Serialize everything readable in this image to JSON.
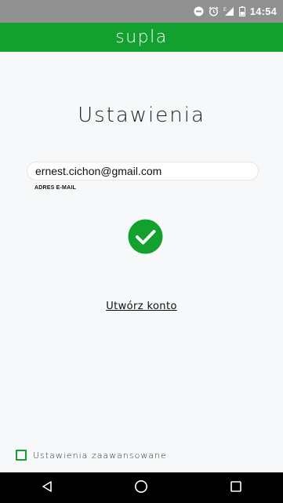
{
  "status_bar": {
    "time": "14:54",
    "icons": [
      "do-not-disturb-icon",
      "alarm-icon",
      "signal-icon",
      "battery-icon"
    ]
  },
  "app_bar": {
    "logo": "supla",
    "color": "#12a12f"
  },
  "page": {
    "title": "Ustawienia"
  },
  "email": {
    "value": "ernest.cichon@gmail.com",
    "label": "ADRES E-MAIL"
  },
  "status": {
    "icon": "check-circle-icon",
    "color": "#12a12f"
  },
  "create_account": {
    "label": "Utwórz konto"
  },
  "advanced": {
    "label": "Ustawienia zaawansowane",
    "checked": false
  },
  "nav": {
    "icons": [
      "back-icon",
      "home-icon",
      "recents-icon"
    ]
  }
}
